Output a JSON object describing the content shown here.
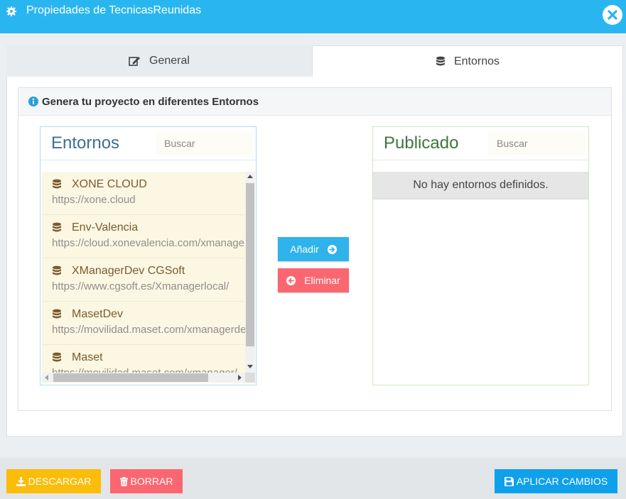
{
  "window": {
    "title": "Propiedades de TecnicasReunidas"
  },
  "tabs": [
    {
      "label": "General",
      "icon": "edit-icon",
      "active": false
    },
    {
      "label": "Entornos",
      "icon": "database-icon",
      "active": true
    }
  ],
  "section": {
    "heading": "Genera tu proyecto en diferentes Entornos"
  },
  "available": {
    "title": "Entornos",
    "search_placeholder": "Buscar",
    "items": [
      {
        "name": "XONE CLOUD",
        "url": "https://xone.cloud"
      },
      {
        "name": "Env-Valencia",
        "url": "https://cloud.xonevalencia.com/xmanagerx"
      },
      {
        "name": "XManagerDev CGSoft",
        "url": "https://www.cgsoft.es/Xmanagerlocal/"
      },
      {
        "name": "MasetDev",
        "url": "https://movilidad.maset.com/xmanagerdev/"
      },
      {
        "name": "Maset",
        "url": "https://movilidad.maset.com/xmanager/"
      }
    ]
  },
  "published": {
    "title": "Publicado",
    "search_placeholder": "Buscar",
    "empty_text": "No hay entornos definidos."
  },
  "actions": {
    "add_label": "Añadir",
    "remove_label": "Eliminar"
  },
  "footer": {
    "download_label": "DESCARGAR",
    "delete_label": "BORRAR",
    "apply_label": "APLICAR CAMBIOS"
  },
  "colors": {
    "header": "#29b6f0",
    "add": "#2fb3ec",
    "remove": "#fa6771",
    "download": "#fbbc0a",
    "apply": "#0fa0ec"
  }
}
